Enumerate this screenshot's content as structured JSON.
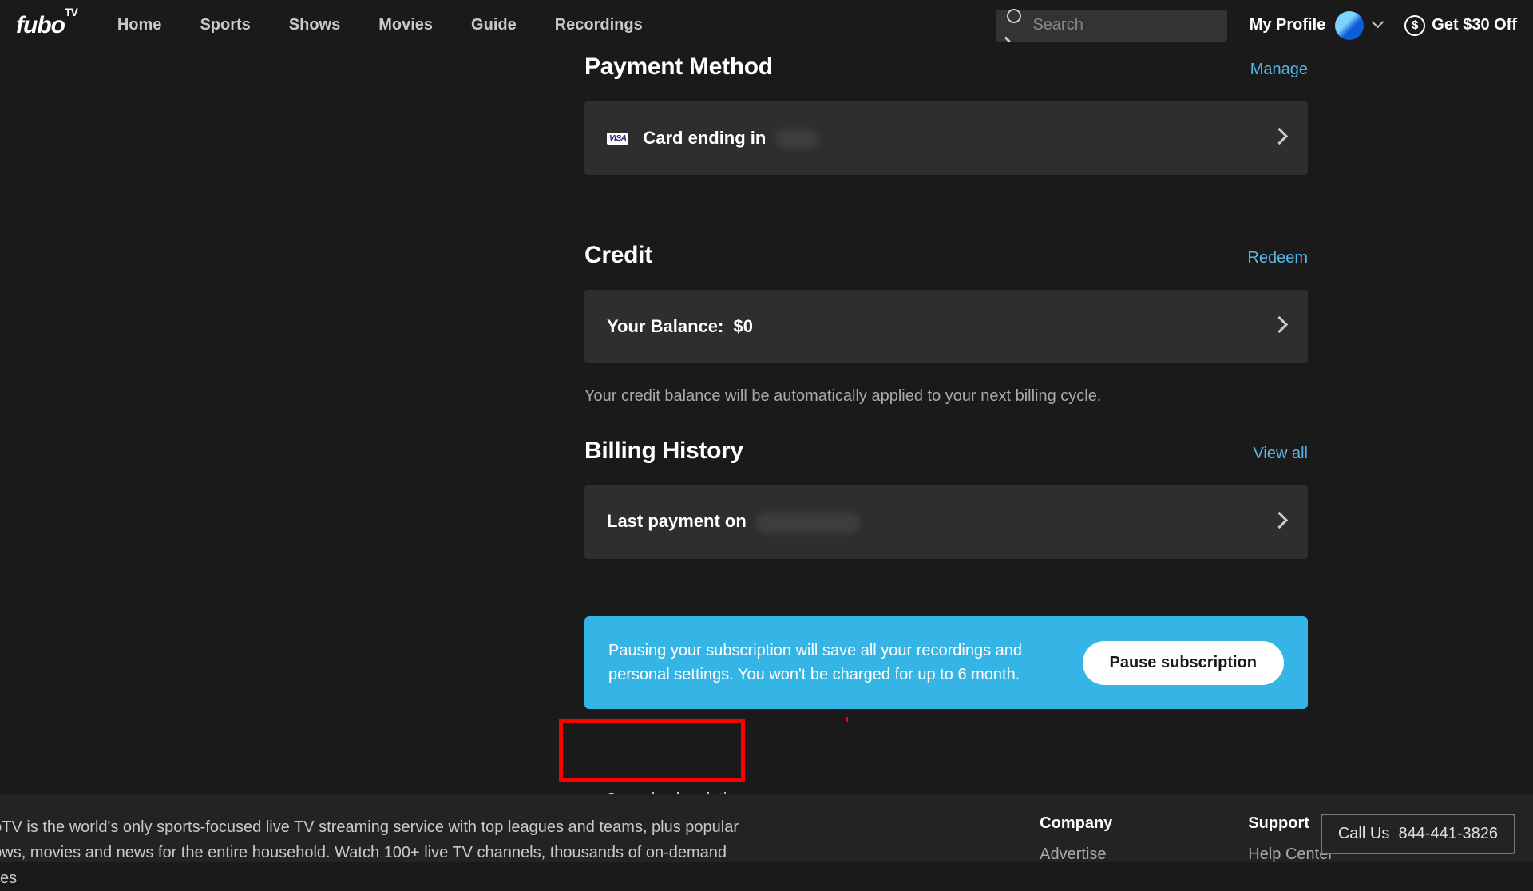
{
  "header": {
    "logo": "fubo",
    "logo_suffix": "TV",
    "nav": [
      "Home",
      "Sports",
      "Shows",
      "Movies",
      "Guide",
      "Recordings"
    ],
    "search_placeholder": "Search",
    "profile_label": "My Profile",
    "offer_label": "Get $30 Off",
    "dollar_glyph": "$"
  },
  "payment": {
    "title": "Payment Method",
    "action": "Manage",
    "card_prefix": "Card ending in"
  },
  "credit": {
    "title": "Credit",
    "action": "Redeem",
    "balance_label": "Your Balance:",
    "balance_value": "$0",
    "helper": "Your credit balance will be automatically applied to your next billing cycle."
  },
  "billing": {
    "title": "Billing History",
    "action": "View all",
    "last_payment_prefix": "Last payment on"
  },
  "pause": {
    "text": "Pausing your subscription will save all your recordings and personal settings. You won't be charged for up to 6 month.",
    "button": "Pause subscription"
  },
  "cancel": {
    "label": "Cancel subscription"
  },
  "footer": {
    "about": "boTV is the world's only sports-focused live TV streaming service with top leagues and teams, plus popular nows, movies and news for the entire household. Watch 100+ live TV channels, thousands of on-demand titles",
    "company_title": "Company",
    "company_link": "Advertise",
    "support_title": "Support",
    "support_link": "Help Center",
    "call_label": "Call Us",
    "call_number": "844-441-3826"
  }
}
